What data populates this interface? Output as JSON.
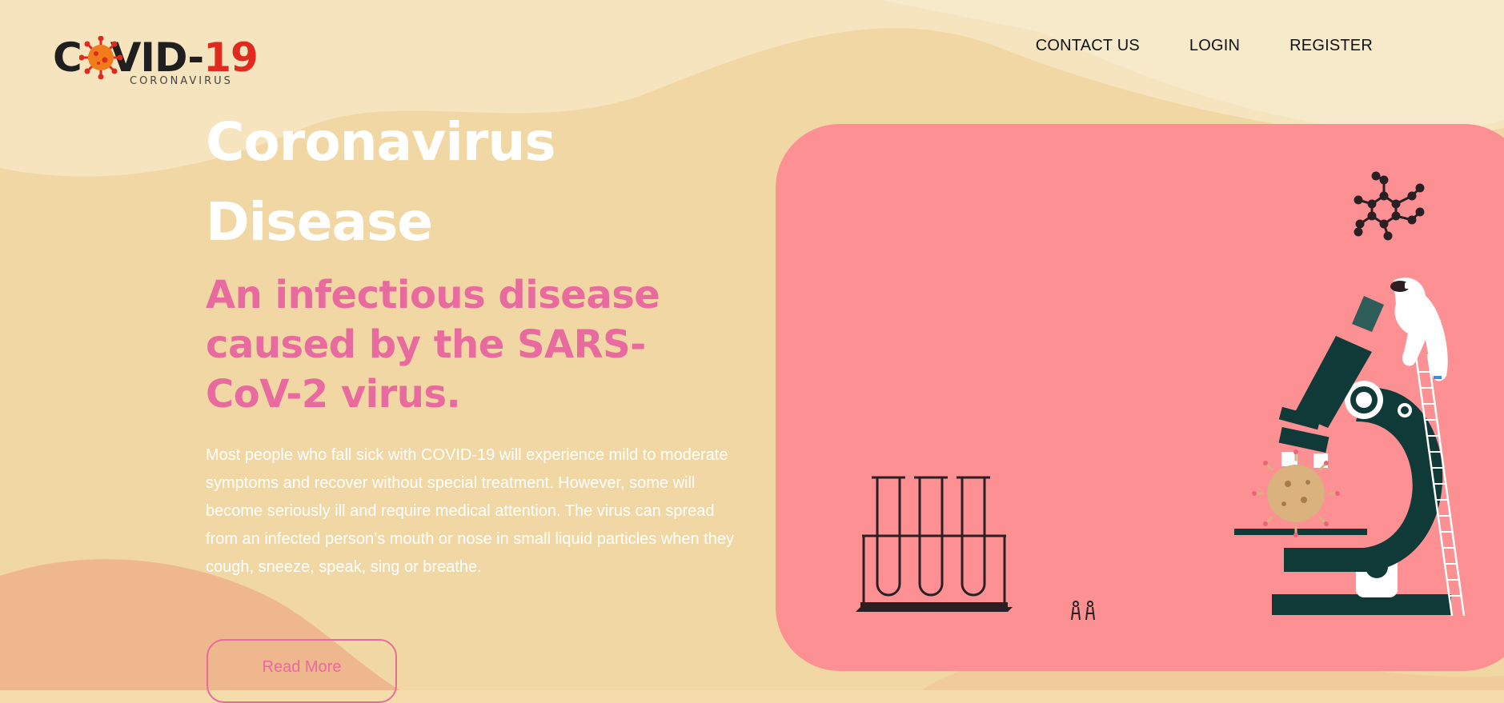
{
  "logo": {
    "text_a": "C",
    "text_b": "VID-",
    "text_num": "19",
    "subtitle": "CORONAVIRUS"
  },
  "nav": {
    "contact": "CONTACT US",
    "login": "LOGIN",
    "register": "REGISTER"
  },
  "hero": {
    "title_line1": "Coronavirus",
    "title_line2": "Disease",
    "subtitle": "An infectious disease caused by the SARS-CoV-2 virus.",
    "description": "Most people who fall sick with COVID-19 will experience mild to moderate symptoms and recover without special treatment. However, some will become seriously ill and require medical attention. The virus can spread from an infected person’s mouth or nose in small liquid particles when they cough, sneeze, speak, sing or breathe.",
    "button_label": "Read More"
  },
  "colors": {
    "background": "#f3dcaa",
    "accent_pink": "#e86a9e",
    "panel": "#fc9093",
    "dark_teal": "#0f3a38",
    "logo_red": "#e02a1d"
  },
  "icons": [
    "virus-icon",
    "molecule-icon",
    "microscope-icon",
    "test-tubes-icon",
    "scientist-icon",
    "ladder-icon",
    "people-icon"
  ]
}
